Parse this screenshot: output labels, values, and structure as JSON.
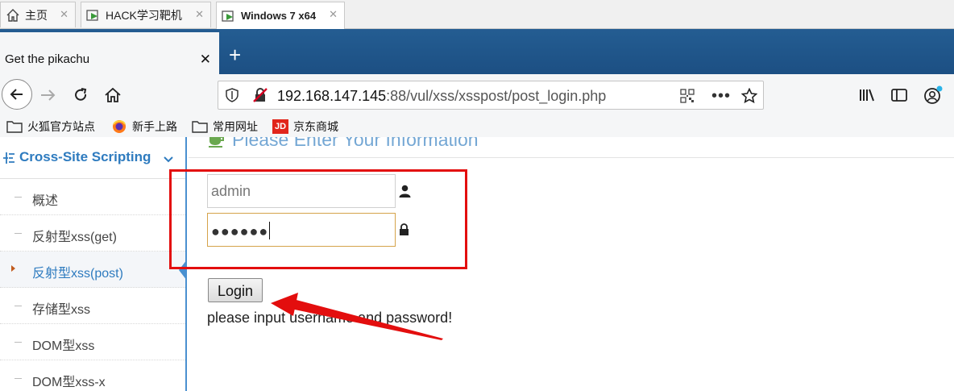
{
  "vm_tabs": [
    {
      "label": "主页",
      "active": false
    },
    {
      "label": "HACK学习靶机",
      "active": false
    },
    {
      "label": "Windows 7 x64",
      "active": true
    }
  ],
  "browser": {
    "tab_title": "Get the pikachu",
    "url_host": "192.168.147.145",
    "url_rest": ":88/vul/xss/xsspost/post_login.php"
  },
  "bookmarks": [
    {
      "label": "火狐官方站点",
      "icon": "folder-icon"
    },
    {
      "label": "新手上路",
      "icon": "firefox-icon"
    },
    {
      "label": "常用网址",
      "icon": "folder-icon"
    },
    {
      "label": "京东商城",
      "icon": "jd-icon",
      "icon_text": "JD"
    }
  ],
  "sidebar": {
    "section_title": "Cross-Site Scripting",
    "items": [
      {
        "label": "概述"
      },
      {
        "label": "反射型xss(get)"
      },
      {
        "label": "反射型xss(post)",
        "active": true
      },
      {
        "label": "存储型xss"
      },
      {
        "label": "DOM型xss"
      },
      {
        "label": "DOM型xss-x"
      }
    ]
  },
  "content": {
    "heading": "Please Enter Your Information",
    "username_value": "admin",
    "password_mask": "●●●●●●",
    "login_label": "Login",
    "message": "please input username and password!"
  },
  "colors": {
    "accent": "#2e7bbf",
    "annotation_red": "#e30e0e",
    "titlebar": "#245d92"
  }
}
